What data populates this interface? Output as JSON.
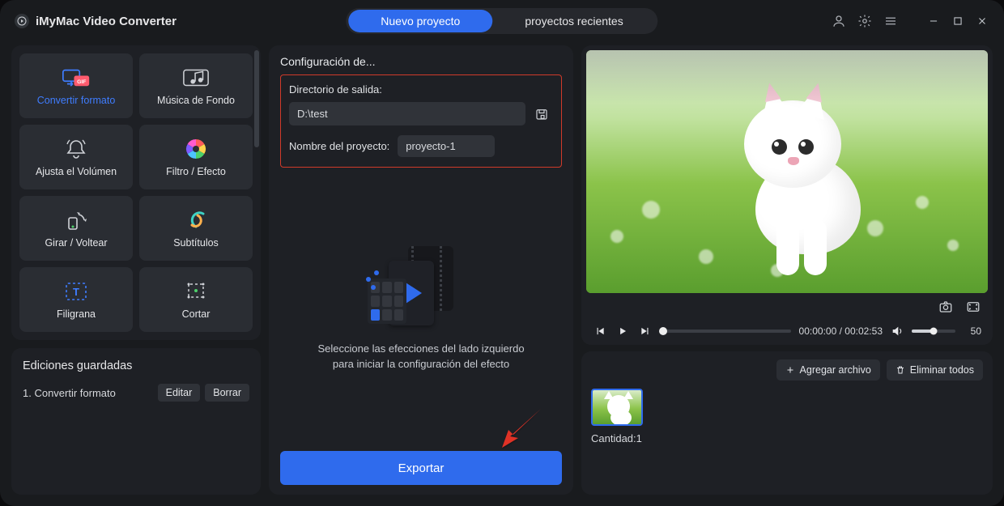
{
  "app": {
    "title": "iMyMac Video Converter"
  },
  "tabs": {
    "new": "Nuevo proyecto",
    "recent": "proyectos recientes"
  },
  "sidebar": {
    "tools": [
      {
        "id": "convert",
        "label": "Convertir formato"
      },
      {
        "id": "music",
        "label": "Música de Fondo"
      },
      {
        "id": "volume",
        "label": "Ajusta el Volúmen"
      },
      {
        "id": "filter",
        "label": "Filtro / Efecto"
      },
      {
        "id": "rotate",
        "label": "Girar / Voltear"
      },
      {
        "id": "subs",
        "label": "Subtítulos"
      },
      {
        "id": "watermark",
        "label": "Filigrana"
      },
      {
        "id": "crop",
        "label": "Cortar"
      }
    ],
    "saved": {
      "title": "Ediciones guardadas",
      "row_label": "1.  Convertir formato",
      "edit": "Editar",
      "delete": "Borrar"
    }
  },
  "center": {
    "title": "Configuración de...",
    "out_dir_label": "Directorio de salida:",
    "out_dir_value": "D:\\test",
    "proj_name_label": "Nombre del proyecto:",
    "proj_name_value": "proyecto-1",
    "placeholder_line1": "Seleccione las efecciones del lado izquierdo",
    "placeholder_line2": "para iniciar la configuración del efecto",
    "export": "Exportar"
  },
  "player": {
    "current": "00:00:00",
    "total": "00:02:53",
    "volume": "50"
  },
  "files": {
    "add": "Agregar archivo",
    "remove_all": "Eliminar todos",
    "count_label": "Cantidad:1"
  }
}
